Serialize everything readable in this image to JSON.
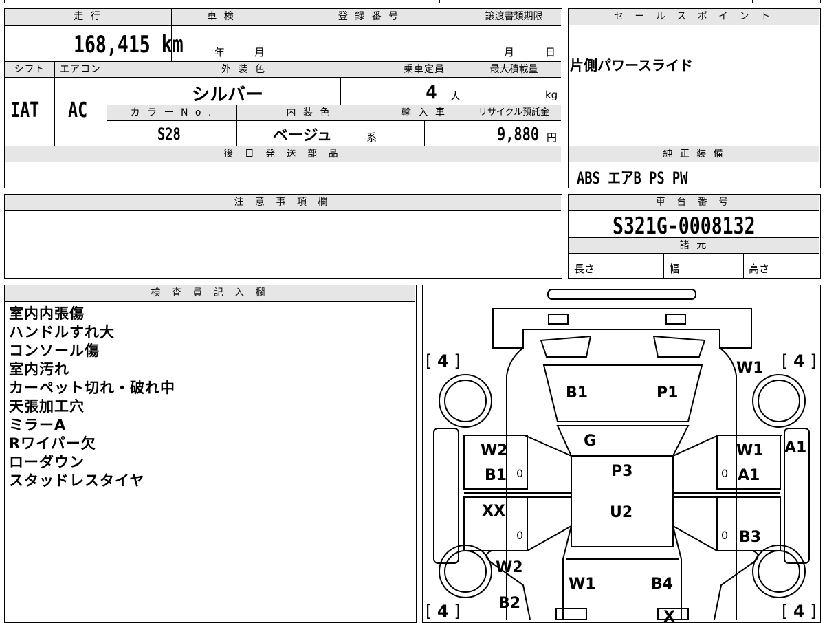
{
  "summary": {
    "headers": {
      "mileage": "走 行",
      "shaken": "車 検",
      "reg_number": "登 録 番 号",
      "transfer_deadline": "譲渡書類期限",
      "shift": "シフト",
      "aircon": "エアコン",
      "exterior_color": "外 装 色",
      "capacity": "乗車定員",
      "max_load": "最大積載量",
      "color_no": "カ ラ ー N o .",
      "interior_color": "内 装 色",
      "import": "輸 入 車",
      "recycle_fee": "リサイクル預託金",
      "later_parts": "後 日 発 送 部 品",
      "notes": "注 意 事 項 欄",
      "inspector": "検 査 員 記 入 欄"
    },
    "mileage_value": "168,415 km",
    "shaken_year": "年",
    "shaken_month": "月",
    "deadline_month": "月",
    "deadline_day": "日",
    "shift_value": "IAT",
    "aircon_value": "AC",
    "exterior_color_value": "シルバー",
    "capacity_value": "4",
    "capacity_unit": "人",
    "max_load_unit": "kg",
    "color_no_value": "S28",
    "interior_color_value": "ベージュ",
    "interior_suffix": "系",
    "recycle_value": "9,880",
    "recycle_unit": "円"
  },
  "right_panel": {
    "sales_header": "セ ー ル ス ポ イ ン ト",
    "sales_point": "片側パワースライド",
    "equipment_header": "純 正 装 備",
    "equipment_value": "ABS エアB PS PW",
    "chassis_header": "車 台 番 号",
    "chassis_value": "S321G-0008132",
    "specs_header": "諸 元",
    "spec_length": "長さ",
    "spec_width": "幅",
    "spec_height": "高さ"
  },
  "inspector_notes": [
    "室内内張傷",
    "ハンドルすれ大",
    "コンソール傷",
    "室内汚れ",
    "カーペット切れ・破れ中",
    "天張加工穴",
    "ミラーA",
    "Rワイパー欠",
    "ローダウン",
    "スタッドレスタイヤ"
  ],
  "diagram": {
    "tire_tl": "4",
    "tire_tr": "4",
    "tire_bl": "4",
    "tire_br": "4",
    "marks": {
      "w1_fr": "W1",
      "b1_hood": "B1",
      "p1_hood": "P1",
      "g_windshield": "G",
      "a1_side": "A1",
      "w2_fl": "W2",
      "b1_fl": "B1",
      "w1_fr_door": "W1",
      "a1_fr_door": "A1",
      "p3_roof": "P3",
      "xx_rl": "XX",
      "u2_roof": "U2",
      "b3_rr": "B3",
      "w2_rl": "W2",
      "w1_back": "W1",
      "b4_back": "B4",
      "b2_rear": "B2",
      "x_rear": "X",
      "zero_1": "0",
      "zero_2": "0",
      "zero_3": "0",
      "zero_4": "0"
    }
  }
}
